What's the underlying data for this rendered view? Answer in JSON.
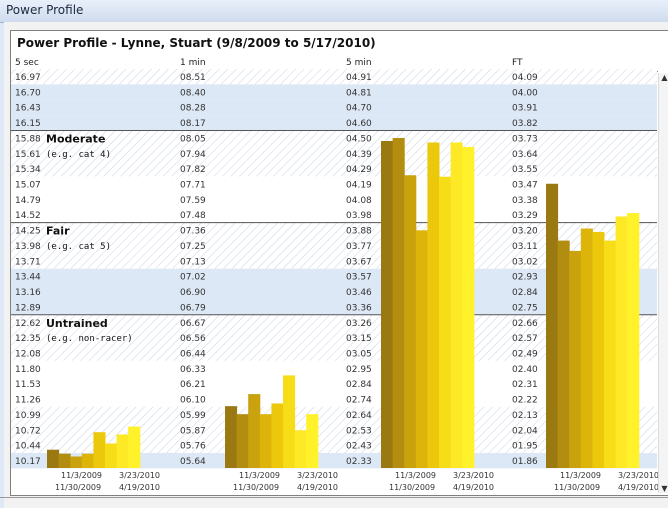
{
  "window": {
    "title": "Power Profile"
  },
  "report": {
    "title": "Power Profile - Lynne, Stuart   (9/8/2009 to 5/17/2010)"
  },
  "columns": [
    {
      "label": "5 sec",
      "values": [
        "16.97",
        "16.70",
        "16.43",
        "16.15",
        "15.88",
        "15.61",
        "15.34",
        "15.07",
        "14.79",
        "14.52",
        "14.25",
        "13.98",
        "13.71",
        "13.44",
        "13.16",
        "12.89",
        "12.62",
        "12.35",
        "12.08",
        "11.80",
        "11.53",
        "11.26",
        "10.99",
        "10.72",
        "10.44",
        "10.17"
      ]
    },
    {
      "label": "1 min",
      "values": [
        "08.51",
        "08.40",
        "08.28",
        "08.17",
        "08.05",
        "07.94",
        "07.82",
        "07.71",
        "07.59",
        "07.48",
        "07.36",
        "07.25",
        "07.13",
        "07.02",
        "06.90",
        "06.79",
        "06.67",
        "06.56",
        "06.44",
        "06.33",
        "06.21",
        "06.10",
        "05.99",
        "05.87",
        "05.76",
        "05.64"
      ]
    },
    {
      "label": "5 min",
      "values": [
        "04.91",
        "04.81",
        "04.70",
        "04.60",
        "04.50",
        "04.39",
        "04.29",
        "04.19",
        "04.08",
        "03.98",
        "03.88",
        "03.77",
        "03.67",
        "03.57",
        "03.46",
        "03.36",
        "03.26",
        "03.15",
        "03.05",
        "02.95",
        "02.84",
        "02.74",
        "02.64",
        "02.53",
        "02.43",
        "02.33"
      ]
    },
    {
      "label": "FT",
      "values": [
        "04.09",
        "04.00",
        "03.91",
        "03.82",
        "03.73",
        "03.64",
        "03.55",
        "03.47",
        "03.38",
        "03.29",
        "03.20",
        "03.11",
        "03.02",
        "02.93",
        "02.84",
        "02.75",
        "02.66",
        "02.57",
        "02.49",
        "02.40",
        "02.31",
        "02.22",
        "02.13",
        "02.04",
        "01.95",
        "01.86"
      ]
    }
  ],
  "categories": [
    {
      "name": "Moderate",
      "note": "(e.g. cat 4)"
    },
    {
      "name": "Fair",
      "note": "(e.g. cat 5)"
    },
    {
      "name": "Untrained",
      "note": "(e.g. non-racer)"
    }
  ],
  "date_labels": [
    "11/3/2009",
    "3/23/2010",
    "11/30/2009",
    "4/19/2010"
  ],
  "colors": {
    "bar_dark": "#9c7a12",
    "bar_light": "#fff22a",
    "band_blue": "#dde8f7",
    "band_white": "#ffffff",
    "hatch": "#c9d3e0"
  },
  "chart_data": [
    {
      "type": "bar",
      "xlabel": "5 sec",
      "values": [
        10.37,
        10.3,
        10.25,
        10.3,
        10.68,
        10.48,
        10.64,
        10.78
      ]
    },
    {
      "type": "bar",
      "xlabel": "1 min",
      "values": [
        6.05,
        5.99,
        6.14,
        5.99,
        6.07,
        6.28,
        5.87,
        5.99
      ]
    },
    {
      "type": "bar",
      "xlabel": "5 min",
      "values": [
        4.48,
        4.5,
        4.25,
        3.88,
        4.47,
        4.24,
        4.47,
        4.44
      ]
    },
    {
      "type": "bar",
      "xlabel": "FT",
      "values": [
        3.47,
        3.14,
        3.08,
        3.21,
        3.19,
        3.14,
        3.28,
        3.3
      ]
    }
  ]
}
